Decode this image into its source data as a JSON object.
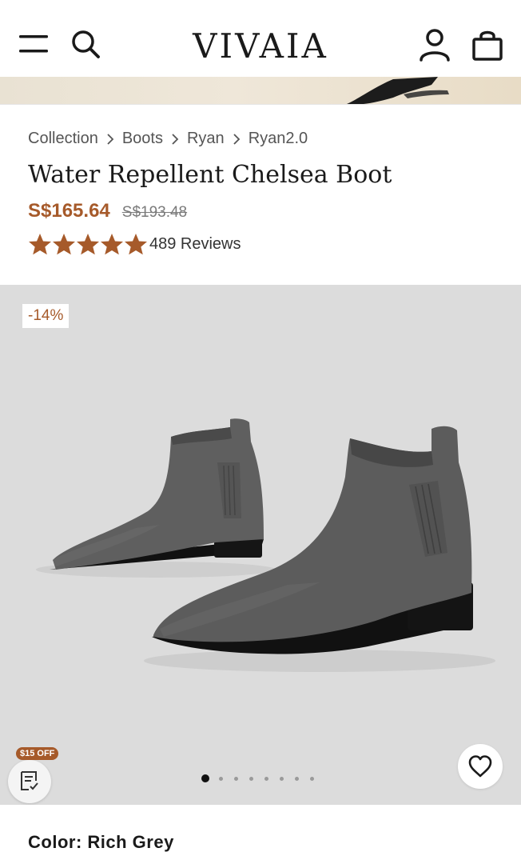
{
  "header": {
    "logo": "VIVAIA",
    "menu_icon": "hamburger-menu-icon",
    "search_icon": "search-icon",
    "account_icon": "user-icon",
    "cart_icon": "shopping-bag-icon"
  },
  "breadcrumb": [
    "Collection",
    "Boots",
    "Ryan",
    "Ryan2.0"
  ],
  "product": {
    "title": "Water Repellent Chelsea Boot",
    "price": "S$165.64",
    "original_price": "S$193.48",
    "rating": 5,
    "reviews_label": "489 Reviews"
  },
  "gallery": {
    "discount_badge": "-14%",
    "coupon_label": "$15 OFF",
    "slide_count": 8,
    "active_slide": 1
  },
  "color": {
    "label": "Color: Rich Grey"
  },
  "colors": {
    "accent": "#a65a2a",
    "gallery_bg": "#dcdcdc",
    "text": "#1a1a1a"
  }
}
